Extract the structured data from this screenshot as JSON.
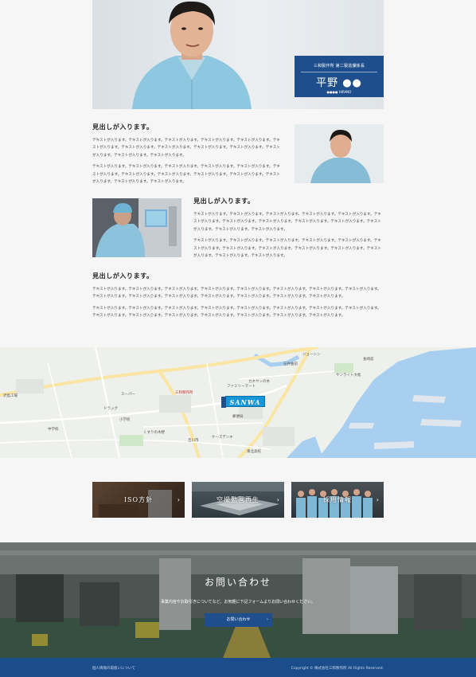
{
  "profile": {
    "department": "三和製作所 第二製造課係長",
    "name": "平野 ●●",
    "name_kana": "●●●● HIRANO"
  },
  "sections": [
    {
      "heading": "見出しが入ります。",
      "paragraphs": [
        "テキストが入ります。テキストが入ります。テキストが入ります。テキストが入ります。テキストが入ります。テキストが入ります。テキストが入ります。テキストが入ります。テキストが入ります。テキストが入ります。テキストが入ります。テキストが入ります。テキストが入ります。",
        "テキストが入ります。テキストが入ります。テキストが入ります。テキストが入ります。テキストが入ります。テキストが入ります。テキストが入ります。テキストが入ります。テキストが入ります。テキストが入ります。テキストが入ります。テキストが入ります。テキストが入ります。"
      ]
    },
    {
      "heading": "見出しが入ります。",
      "paragraphs": [
        "テキストが入ります。テキストが入ります。テキストが入ります。テキストが入ります。テキストが入ります。テキストが入ります。テキストが入ります。テキストが入ります。テキストが入ります。テキストが入ります。テキストが入ります。テキストが入ります。テキストが入ります。",
        "テキストが入ります。テキストが入ります。テキストが入ります。テキストが入ります。テキストが入ります。テキストが入ります。テキストが入ります。テキストが入ります。テキストが入ります。テキストが入ります。テキストが入ります。テキストが入ります。テキストが入ります。"
      ]
    },
    {
      "heading": "見出しが入ります。",
      "paragraphs": [
        "テキストが入ります。テキストが入ります。テキストが入ります。テキストが入ります。テキストが入ります。テキストが入ります。テキストが入ります。テキストが入ります。テキストが入ります。テキストが入ります。テキストが入ります。テキストが入ります。テキストが入ります。テキストが入ります。テキストが入ります。",
        "テキストが入ります。テキストが入ります。テキストが入ります。テキストが入ります。テキストが入ります。テキストが入ります。テキストが入ります。テキストが入ります。テキストが入ります。テキストが入ります。テキストが入ります。テキストが入ります。テキストが入ります。テキストが入ります。テキストが入ります。"
      ]
    }
  ],
  "map": {
    "logo": "SANWA",
    "labels": [
      "ジョーシン",
      "サンライト大松",
      "長崎前",
      "石井曲前",
      "カネヤンの木",
      "沢島工場",
      "三和製作所",
      "スーパー",
      "ドラッグ",
      "ファミリーマート",
      "くすりの木野",
      "ケーズデンキ",
      "吉川市",
      "郵便局",
      "中学校",
      "小学校",
      "東北高校"
    ]
  },
  "banners": [
    {
      "label": "ISO方針",
      "arrow": "›"
    },
    {
      "label": "空撮動画再生",
      "arrow": "›"
    },
    {
      "label": "採用情報",
      "arrow": "›"
    }
  ],
  "contact": {
    "title": "お問い合わせ",
    "description": "事業内容やお取引きについてなど、お気軽に下記フォームよりお問い合わせください。",
    "button": "お問い合わせ",
    "button_arrow": "›"
  },
  "footer": {
    "privacy": "個人情報の取扱いについて",
    "copyright": "Copyright © 株式会社三和製作所 All Rights Reserved."
  },
  "colors": {
    "brand_blue": "#1f4e8c",
    "footer_blue": "#1c4d8b",
    "map_water": "#a9cff0",
    "map_logo": "#1596d6"
  }
}
